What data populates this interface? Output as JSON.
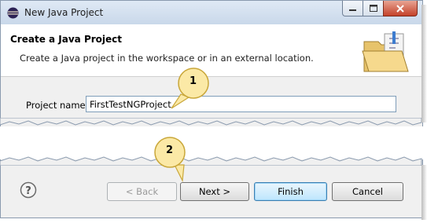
{
  "window": {
    "title": "New Java Project"
  },
  "header": {
    "title": "Create a Java Project",
    "description": "Create a Java project in the workspace or in an external location."
  },
  "form": {
    "project_name_label": "Project name:",
    "project_name_value": "FirstTestNGProject"
  },
  "buttons": {
    "back": "< Back",
    "next": "Next >",
    "finish": "Finish",
    "cancel": "Cancel"
  },
  "callouts": {
    "first": "1",
    "second": "2"
  },
  "colors": {
    "callout_fill": "#fbe9a6",
    "callout_border": "#c9a73a",
    "finish_border": "#3c7fb1"
  },
  "icons": {
    "app": "eclipse-icon",
    "header": "java-project-folder-icon",
    "help": "help-icon"
  }
}
